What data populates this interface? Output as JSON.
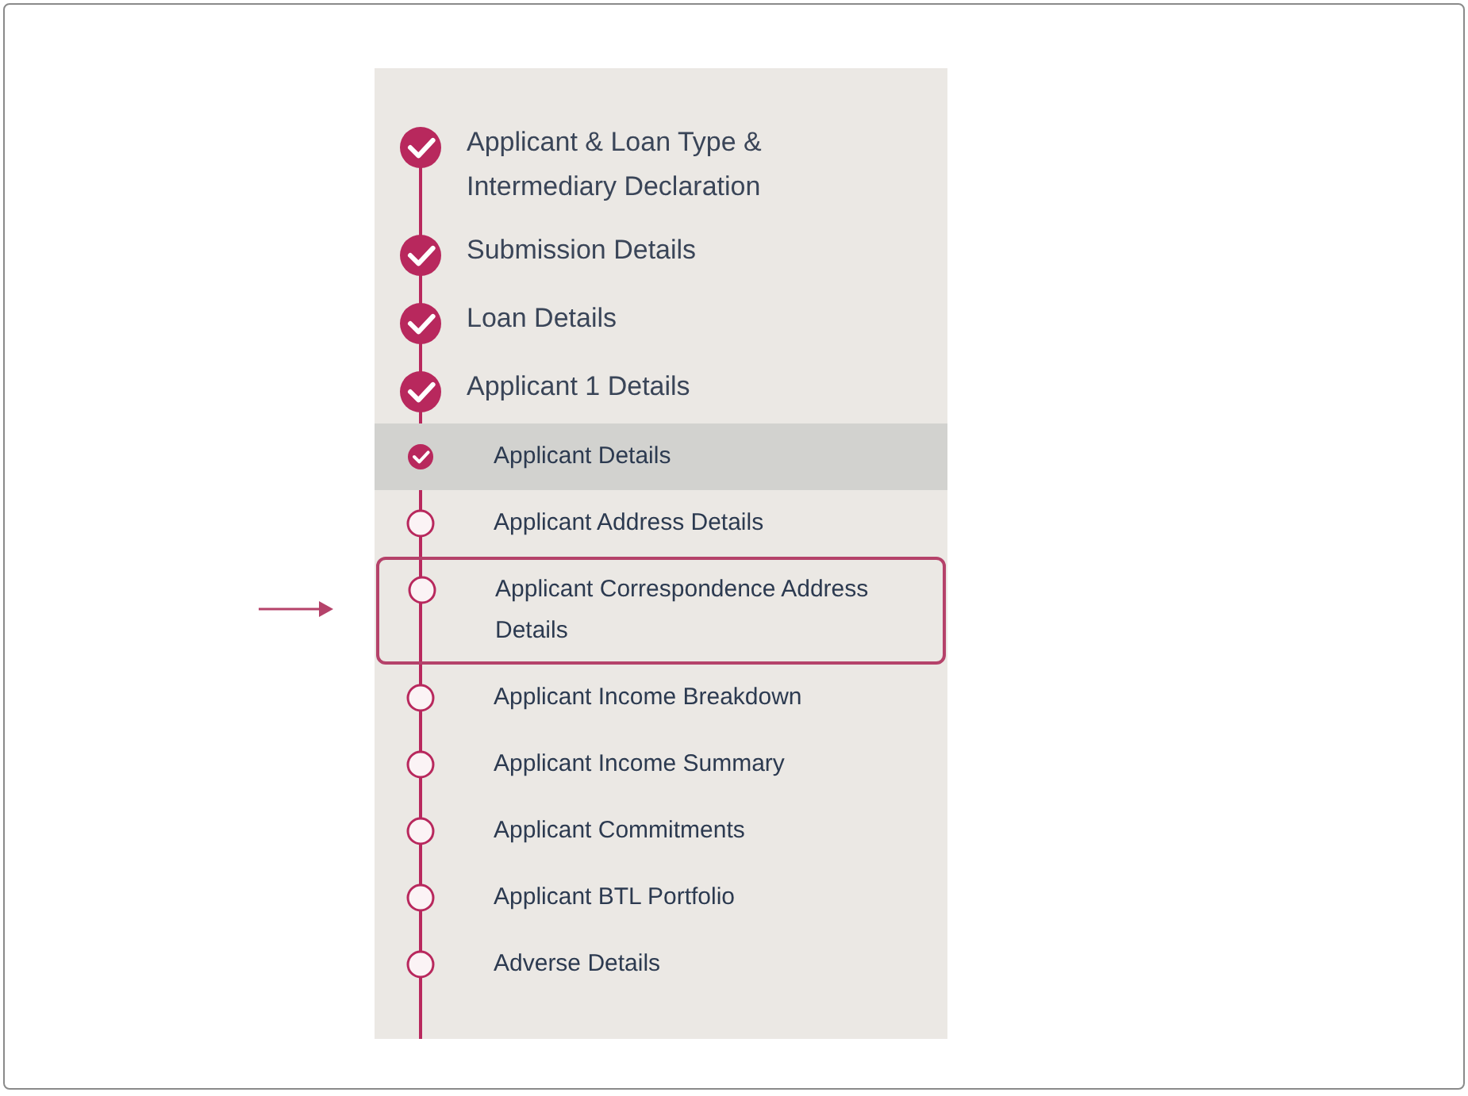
{
  "steps": [
    {
      "kind": "main",
      "label": "Applicant & Loan Type & Intermediary Declaration",
      "completed": true,
      "selected": false,
      "highlighted": false
    },
    {
      "kind": "main",
      "label": "Submission Details",
      "completed": true,
      "selected": false,
      "highlighted": false
    },
    {
      "kind": "main",
      "label": "Loan Details",
      "completed": true,
      "selected": false,
      "highlighted": false
    },
    {
      "kind": "main",
      "label": "Applicant 1 Details",
      "completed": true,
      "selected": false,
      "highlighted": false
    },
    {
      "kind": "sub",
      "label": "Applicant Details",
      "completed": true,
      "selected": true,
      "highlighted": false
    },
    {
      "kind": "sub",
      "label": "Applicant Address Details",
      "completed": false,
      "selected": false,
      "highlighted": false
    },
    {
      "kind": "sub",
      "label": "Applicant Correspondence Address Details",
      "completed": false,
      "selected": false,
      "highlighted": true
    },
    {
      "kind": "sub",
      "label": "Applicant Income Breakdown",
      "completed": false,
      "selected": false,
      "highlighted": false
    },
    {
      "kind": "sub",
      "label": "Applicant Income Summary",
      "completed": false,
      "selected": false,
      "highlighted": false
    },
    {
      "kind": "sub",
      "label": "Applicant Commitments",
      "completed": false,
      "selected": false,
      "highlighted": false
    },
    {
      "kind": "sub",
      "label": "Applicant BTL Portfolio",
      "completed": false,
      "selected": false,
      "highlighted": false
    },
    {
      "kind": "sub",
      "label": "Adverse Details",
      "completed": false,
      "selected": false,
      "highlighted": false
    }
  ]
}
